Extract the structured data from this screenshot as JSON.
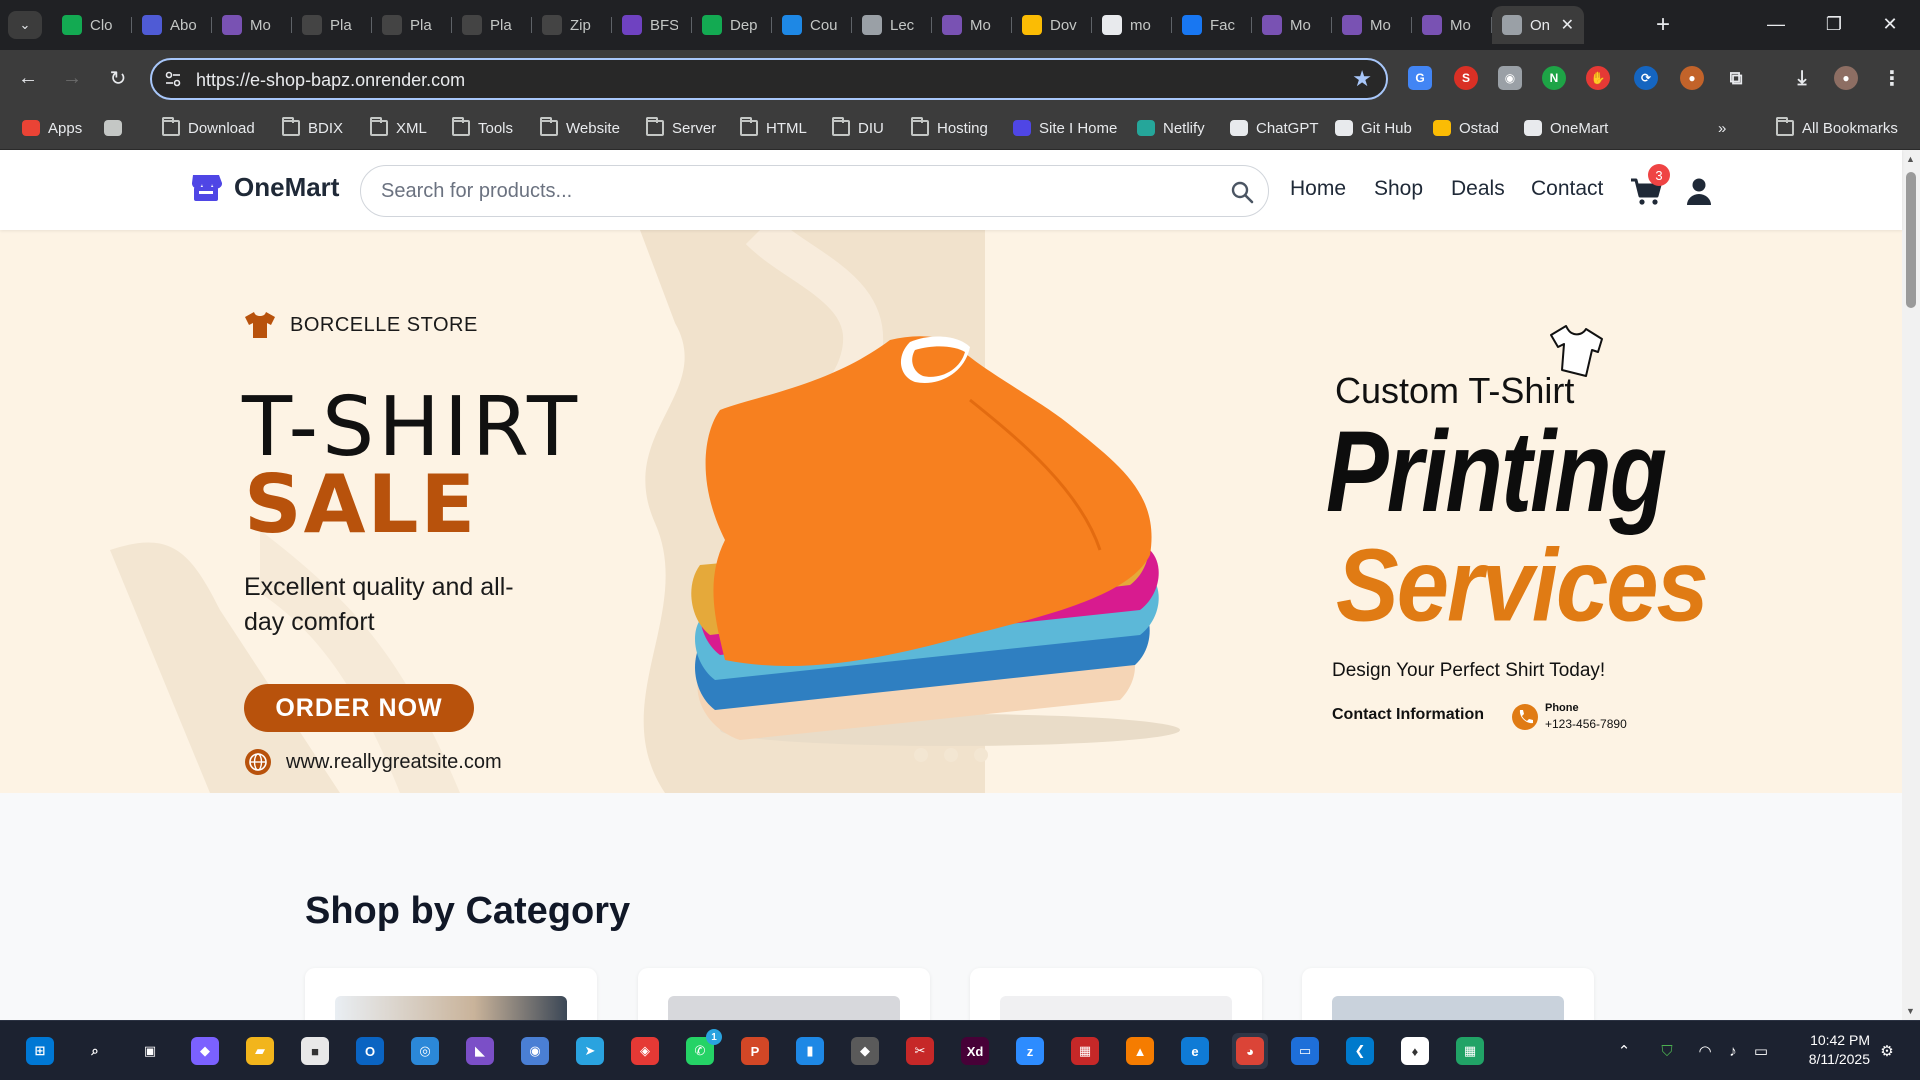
{
  "browser": {
    "tabs": [
      {
        "title": "Clo",
        "icon": "leaf-icon",
        "color": "#13aa52"
      },
      {
        "title": "Abo",
        "icon": "window-icon",
        "color": "#4f5bd5"
      },
      {
        "title": "Mo",
        "icon": "bootstrap-icon",
        "color": "#7952b3"
      },
      {
        "title": "Pla",
        "icon": "feather-icon",
        "color": "#444444"
      },
      {
        "title": "Pla",
        "icon": "feather-icon",
        "color": "#444444"
      },
      {
        "title": "Pla",
        "icon": "feather-icon",
        "color": "#444444"
      },
      {
        "title": "Zip",
        "icon": "feather-icon",
        "color": "#444444"
      },
      {
        "title": "BFS",
        "icon": "bfs-icon",
        "color": "#6f42c1"
      },
      {
        "title": "Dep",
        "icon": "infinity-icon",
        "color": "#13aa52"
      },
      {
        "title": "Cou",
        "icon": "pen-icon",
        "color": "#1e88e5"
      },
      {
        "title": "Lec",
        "icon": "globe-icon",
        "color": "#9aa0a6"
      },
      {
        "title": "Mo",
        "icon": "bootstrap-icon",
        "color": "#7952b3"
      },
      {
        "title": "Dov",
        "icon": "drive-icon",
        "color": "#fbbc04"
      },
      {
        "title": "mo",
        "icon": "github-icon",
        "color": "#e8eaed"
      },
      {
        "title": "Fac",
        "icon": "facebook-icon",
        "color": "#1877f2"
      },
      {
        "title": "Mo",
        "icon": "bootstrap-icon",
        "color": "#7952b3"
      },
      {
        "title": "Mo",
        "icon": "bootstrap-icon",
        "color": "#7952b3"
      },
      {
        "title": "Mo",
        "icon": "bootstrap-icon",
        "color": "#7952b3"
      },
      {
        "title": "On",
        "icon": "globe-icon",
        "color": "#9aa0a6"
      }
    ],
    "url": "https://e-shop-bapz.onrender.com",
    "bookmarks": [
      {
        "label": "Apps",
        "icon": "apps-grid-icon"
      },
      {
        "label": "",
        "icon": "tab-groups-icon"
      },
      {
        "label": "Download",
        "icon": "folder-icon"
      },
      {
        "label": "BDIX",
        "icon": "folder-icon"
      },
      {
        "label": "XML",
        "icon": "folder-icon"
      },
      {
        "label": "Tools",
        "icon": "folder-icon"
      },
      {
        "label": "Website",
        "icon": "folder-icon"
      },
      {
        "label": "Server",
        "icon": "folder-icon"
      },
      {
        "label": "HTML",
        "icon": "folder-icon"
      },
      {
        "label": "DIU",
        "icon": "folder-icon"
      },
      {
        "label": "Hosting",
        "icon": "folder-icon"
      },
      {
        "label": "Site I Home",
        "icon": "site-icon"
      },
      {
        "label": "Netlify",
        "icon": "netlify-icon"
      },
      {
        "label": "ChatGPT",
        "icon": "chatgpt-icon"
      },
      {
        "label": "Git Hub",
        "icon": "github-icon"
      },
      {
        "label": "Ostad",
        "icon": "ostad-icon"
      },
      {
        "label": "OneMart",
        "icon": "github-icon"
      }
    ],
    "all_bookmarks": "All Bookmarks"
  },
  "site": {
    "logo": "OneMart",
    "search_placeholder": "Search for products...",
    "nav": [
      "Home",
      "Shop",
      "Deals",
      "Contact"
    ],
    "cart_count": "3"
  },
  "hero": {
    "brand": "BORCELLE STORE",
    "headline_1": "T-SHIRT",
    "headline_2": "SALE",
    "tagline": "Excellent quality and all-day comfort",
    "cta": "ORDER NOW",
    "website": "www.reallygreatsite.com",
    "custom_line": "Custom T-Shirt",
    "printing": "Printing",
    "services": "Services",
    "design_line": "Design Your Perfect Shirt Today!",
    "contact_title": "Contact Information",
    "phone_label": "Phone",
    "phone_number": "+123-456-7890",
    "colors": {
      "accent": "#b8520c",
      "services": "#e07b14",
      "background": "#fdf3e4"
    }
  },
  "categories": {
    "title": "Shop by Category"
  },
  "taskbar": {
    "apps": [
      "start-icon",
      "search-icon",
      "task-view-icon",
      "copilot-icon",
      "file-explorer-icon",
      "store-icon",
      "outlook-icon",
      "app-icon",
      "visual-studio-icon",
      "sync-icon",
      "telegram-icon",
      "anydesk-icon",
      "whatsapp-icon",
      "powerpoint-icon",
      "video-icon",
      "git-icon",
      "snipping-icon",
      "adobe-xd-icon",
      "zoom-icon",
      "winrar-icon",
      "app-icon",
      "edge-icon",
      "chrome-icon",
      "sandbox-icon",
      "vscode-icon",
      "mongodb-icon",
      "excel-icon"
    ],
    "whatsapp_badge": "1",
    "time": "10:42 PM",
    "date": "8/11/2025"
  }
}
